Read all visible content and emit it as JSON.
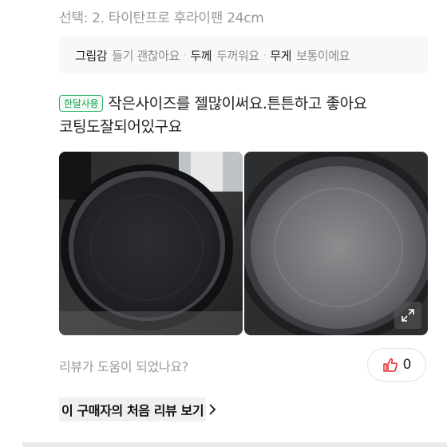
{
  "option": {
    "text": "선택: 2. 타이탄프로 후라이팬 24cm"
  },
  "attributes": [
    {
      "key": "그립감",
      "value": "들기 괜찮아요"
    },
    {
      "key": "두께",
      "value": "두꺼워요"
    },
    {
      "key": "무게",
      "value": "보통이에요"
    }
  ],
  "review": {
    "badge": "한달사용",
    "line1": "작은사이즈를 젤많이써요.튼튼하고 좋아요",
    "line2": "코팅도잘되어있구요"
  },
  "photos": {
    "expand_icon": "expand-arrows-icon"
  },
  "feedback": {
    "question": "리뷰가 도움이 되었나요?",
    "like_count": "0",
    "accent_color": "#e8262b"
  },
  "first_review_link": {
    "label": "이 구매자의 처음 리뷰 보기"
  },
  "colors": {
    "badge_green": "#0c9f4b",
    "muted_text": "#9a9a9a"
  }
}
